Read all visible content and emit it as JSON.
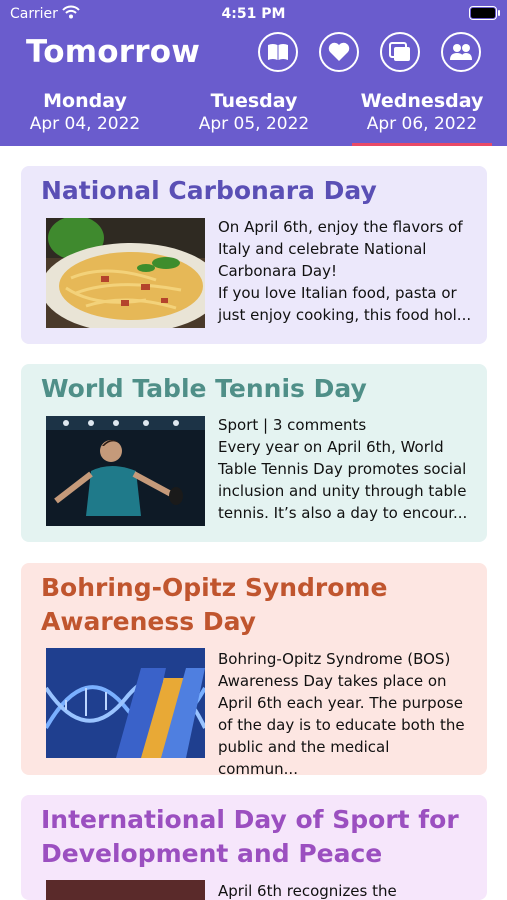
{
  "status_bar": {
    "carrier": "Carrier",
    "time": "4:51 PM"
  },
  "header": {
    "title": "Tomorrow",
    "icons": [
      "book-icon",
      "heart-icon",
      "gallery-icon",
      "people-icon"
    ],
    "days": [
      {
        "name": "Monday",
        "date": "Apr 04, 2022"
      },
      {
        "name": "Tuesday",
        "date": "Apr 05, 2022"
      },
      {
        "name": "Wednesday",
        "date": "Apr 06, 2022"
      }
    ],
    "selected_day": "Wednesday"
  },
  "cards": [
    {
      "title": "National Carbonara Day",
      "text": "On April 6th, enjoy the flavors of\nItaly and celebrate National\nCarbonara Day!\nIf you love Italian food, pasta or\njust enjoy cooking, this food hol...",
      "title_color": "#5a4fb5",
      "bg": "#ece8fb"
    },
    {
      "title": "World Table Tennis Day",
      "text": "Sport | 3 comments\nEvery year on April 6th, World\nTable Tennis Day promotes social\ninclusion and unity through table\ntennis. It’s also a day to encour...",
      "title_color": "#4f8f88",
      "bg": "#e4f3f1"
    },
    {
      "title": "Bohring-Opitz Syndrome Awareness Day",
      "text": "Bohring-Opitz Syndrome (BOS)\nAwareness Day takes place on\nApril 6th each year. The purpose\nof the day is to educate both the\npublic and the medical commun...",
      "title_color": "#c0552e",
      "bg": "#fde6e2"
    },
    {
      "title": "International Day of Sport for Development and Peace",
      "text": "April 6th recognizes the",
      "title_color": "#9b4fc0",
      "bg": "#f6e6fb"
    }
  ]
}
